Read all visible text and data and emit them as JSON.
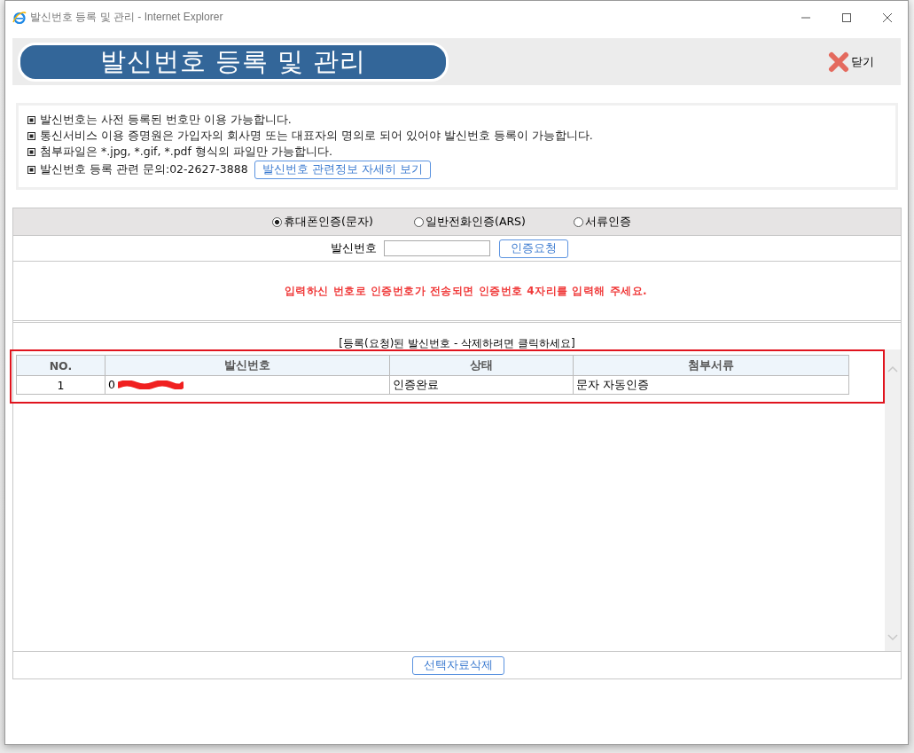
{
  "window": {
    "title": "발신번호 등록 및 관리 - Internet Explorer"
  },
  "header": {
    "title": "발신번호 등록 및 관리",
    "close_label": "닫기"
  },
  "notices": [
    {
      "text": "발신번호는 사전 등록된 번호만 이용 가능합니다."
    },
    {
      "text": "통신서비스 이용 증명원은 가입자의 회사명 또는 대표자의 명의로 되어 있어야 발신번호 등록이 가능합니다."
    },
    {
      "text": "첨부파일은 *.jpg, *.gif, *.pdf 형식의 파일만 가능합니다."
    },
    {
      "text": "발신번호 등록 관련 문의:02-2627-3888",
      "button": "발신번호 관련정보 자세히 보기"
    }
  ],
  "auth_methods": [
    {
      "label": "휴대폰인증(문자)",
      "selected": true
    },
    {
      "label": "일반전화인증(ARS)",
      "selected": false
    },
    {
      "label": "서류인증",
      "selected": false
    }
  ],
  "phone_form": {
    "label": "발신번호",
    "button": "인증요청"
  },
  "message": "입력하신 번호로 인증번호가 전송되면 인증번호 4자리를 입력해 주세요.",
  "table": {
    "caption": "[등록(요청)된 발신번호 - 삭제하려면 클릭하세요]",
    "highlighted": true,
    "columns": [
      "NO.",
      "발신번호",
      "상태",
      "첨부서류"
    ],
    "rows": [
      {
        "cells": [
          "1",
          "0",
          "인증완료",
          "문자 자동인증"
        ],
        "redacted": true
      }
    ]
  },
  "delete_button": "선택자료삭제"
}
